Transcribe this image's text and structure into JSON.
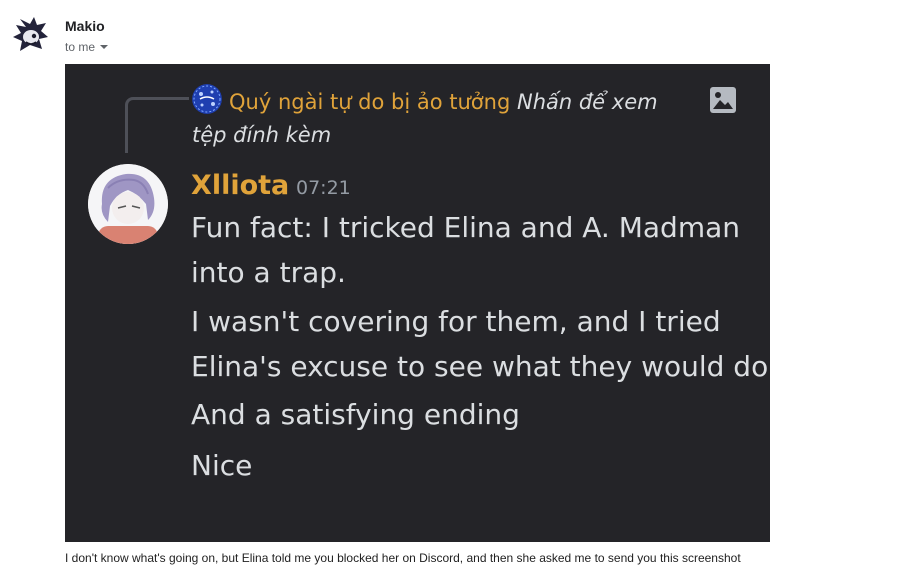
{
  "email": {
    "sender_name": "Makio",
    "recipient_label": "to me",
    "body_text": "I don't know what's going on, but Elina told me you blocked her on Discord, and then she asked me to send you this screenshot"
  },
  "screenshot": {
    "reply": {
      "author": "Quý ngài tự do bị ảo tưởng",
      "text": "Nhấn để xem tệp đính kèm",
      "author_color": "#e0a33a"
    },
    "message": {
      "username": "Xlliota",
      "timestamp": "07:21",
      "username_color": "#e0a33a",
      "lines": [
        "Fun fact: I tricked Elina and A. Madman",
        "into a trap.",
        "I wasn't covering for them, and I tried",
        "Elina's excuse to see what they would do",
        "And a satisfying ending",
        "Nice"
      ]
    },
    "background": "#242428"
  },
  "icons": {
    "sender_avatar": "cartoon-hedgehog-avatar",
    "reply_avatar": "blue-globe-avatar",
    "attachment": "image-icon",
    "message_avatar": "purple-hair-anime-avatar",
    "dropdown": "caret-down-icon"
  }
}
